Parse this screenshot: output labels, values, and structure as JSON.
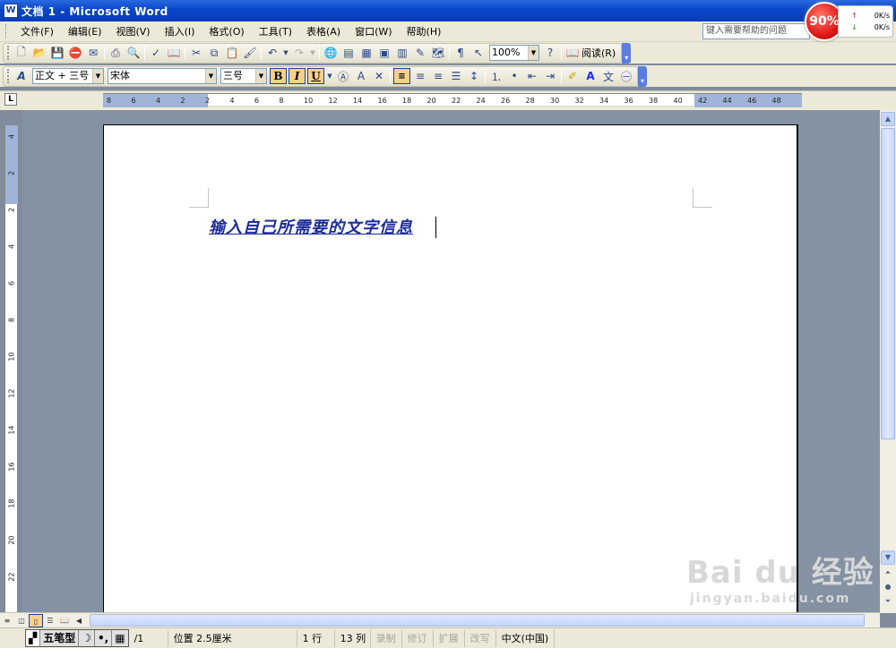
{
  "window": {
    "title": "文档 1 - Microsoft Word",
    "icon_letter": "W"
  },
  "menu": [
    "文件(F)",
    "编辑(E)",
    "视图(V)",
    "插入(I)",
    "格式(O)",
    "工具(T)",
    "表格(A)",
    "窗口(W)",
    "帮助(H)"
  ],
  "help_placeholder": "键入需要帮助的问题",
  "toolbar_standard": {
    "zoom": "100%",
    "read_label": "阅读(R)"
  },
  "toolbar_format": {
    "style": "正文 + 三号",
    "font": "宋体",
    "size": "三号",
    "bold": "B",
    "italic": "I",
    "underline": "U"
  },
  "ruler": {
    "h_labels": [
      "8",
      "6",
      "4",
      "2",
      "2",
      "4",
      "6",
      "8",
      "10",
      "12",
      "14",
      "16",
      "18",
      "20",
      "22",
      "24",
      "26",
      "28",
      "30",
      "32",
      "34",
      "36",
      "38",
      "40",
      "42",
      "44",
      "46",
      "48"
    ],
    "v_labels": [
      "4",
      "2",
      "2",
      "4",
      "6",
      "8",
      "10",
      "12",
      "14",
      "16",
      "18",
      "20",
      "22"
    ]
  },
  "document": {
    "text": "输入自己所需要的文字信息"
  },
  "status": {
    "pages": "/1",
    "position": "位置 2.5厘米",
    "line": "1 行",
    "col": "13 列",
    "rec": "录制",
    "trk": "修订",
    "ext": "扩展",
    "ovr": "改写",
    "lang": "中文(中国)"
  },
  "ime": {
    "name": "五笔型",
    "moon": "☽",
    "punct": "•,",
    "kbd": "▦"
  },
  "network": {
    "percent": "90%",
    "up": "0K/s",
    "down": "0K/s"
  },
  "watermark": {
    "brand": "Bai du 经验",
    "url": "jingyan.baidu.com"
  }
}
